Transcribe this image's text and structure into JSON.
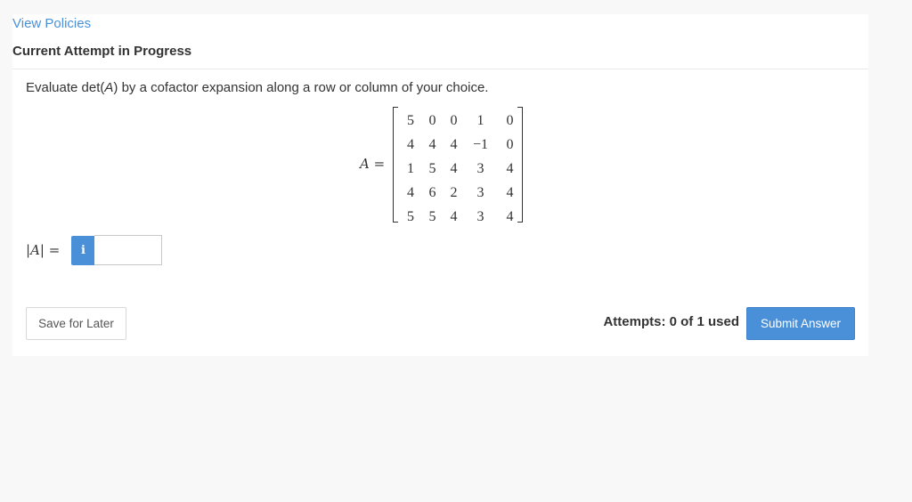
{
  "header": {
    "policies_link": "View Policies",
    "attempt_title": "Current Attempt in Progress"
  },
  "question": {
    "text_prefix": "Evaluate det(",
    "text_var": "A",
    "text_suffix": ") by a cofactor expansion along a row or column of your choice.",
    "matrix_var": "A",
    "matrix_equals": " =",
    "matrix": [
      [
        "5",
        "0",
        "0",
        "1",
        "0"
      ],
      [
        "4",
        "4",
        "4",
        "−1",
        "0"
      ],
      [
        "1",
        "5",
        "4",
        "3",
        "4"
      ],
      [
        "4",
        "6",
        "2",
        "3",
        "4"
      ],
      [
        "5",
        "5",
        "4",
        "3",
        "4"
      ]
    ]
  },
  "answer": {
    "label_open": "|",
    "label_var": "A",
    "label_close": "| =",
    "info_icon": "i",
    "input_value": ""
  },
  "footer": {
    "save_label": "Save for Later",
    "attempts_text": "Attempts: 0 of 1 used",
    "submit_label": "Submit Answer"
  },
  "colors": {
    "accent": "#4a90d9",
    "background": "#f8f8f8",
    "card": "#ffffff"
  }
}
